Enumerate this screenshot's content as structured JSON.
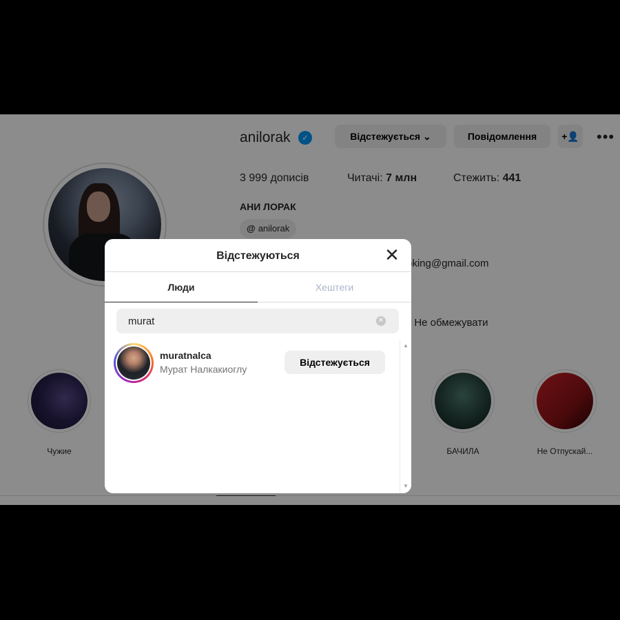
{
  "profile": {
    "username": "anilorak",
    "verified_icon": "verified-badge-icon",
    "following_button": "Відстежується",
    "message_button": "Повідомлення",
    "add_user_icon": "+👤",
    "more_icon": "•••",
    "stats": {
      "posts": "3 999 дописів",
      "followers_label": "Читачі:",
      "followers_value": "7 млн",
      "following_label": "Стежить:",
      "following_value": "441"
    },
    "full_name": "АНИ ЛОРАК",
    "threads_handle": "anilorak",
    "threads_icon": "@",
    "email_fragment": "oking@gmail.com",
    "bio_fragment": ". Не обмежувати"
  },
  "highlights": [
    {
      "label": "Чужие"
    },
    {
      "label": "БАЧИЛА"
    },
    {
      "label": "Не Отпускай..."
    }
  ],
  "modal": {
    "title": "Відстежуються",
    "close_icon": "✕",
    "tabs": [
      {
        "label": "Люди"
      },
      {
        "label": "Хештеги"
      }
    ],
    "search": {
      "value": "murat",
      "clear_icon": "✕"
    },
    "results": [
      {
        "username": "muratnalca",
        "full_name": "Мурат Налкакиоглу",
        "button": "Відстежується"
      }
    ],
    "scroll_up_icon": "▲",
    "scroll_down_icon": "▼"
  }
}
